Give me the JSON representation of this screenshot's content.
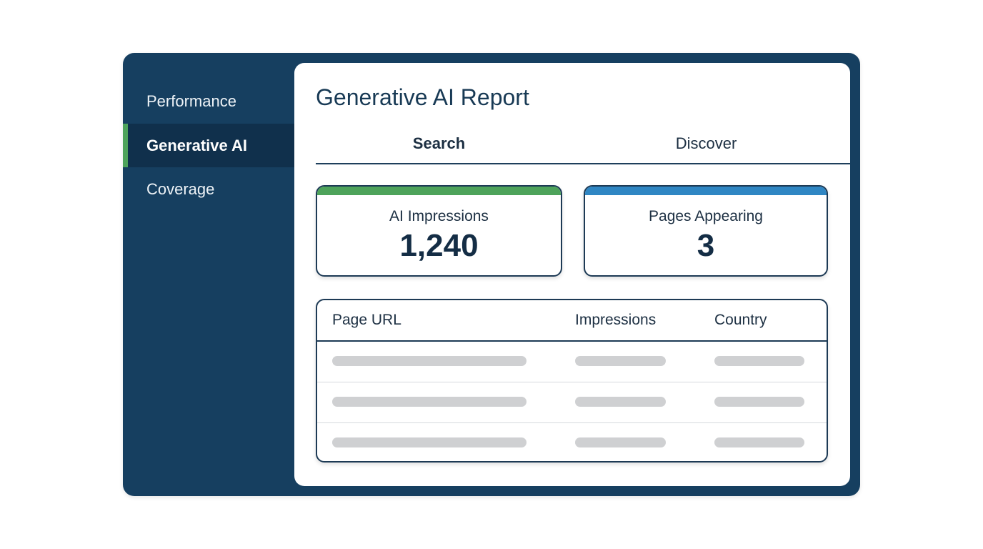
{
  "sidebar": {
    "items": [
      {
        "label": "Performance"
      },
      {
        "label": "Generative AI"
      },
      {
        "label": "Coverage"
      }
    ]
  },
  "main": {
    "title": "Generative AI Report",
    "tabs": [
      {
        "label": "Search"
      },
      {
        "label": "Discover"
      }
    ],
    "stats": [
      {
        "label": "AI Impressions",
        "value": "1,240",
        "accent": "#4ea35b"
      },
      {
        "label": "Pages Appearing",
        "value": "3",
        "accent": "#2f86c3"
      }
    ],
    "table": {
      "headers": [
        "Page URL",
        "Impressions",
        "Country"
      ]
    }
  }
}
